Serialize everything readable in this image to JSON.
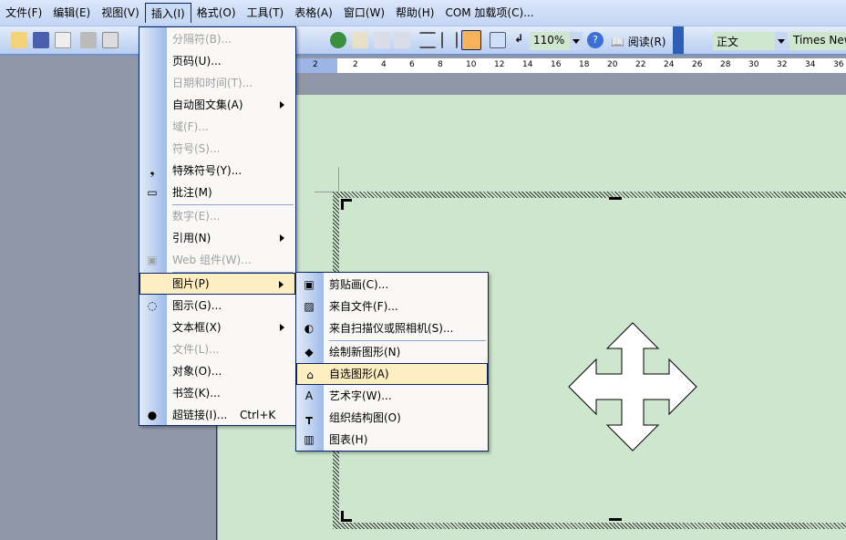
{
  "menubar": [
    "文件(F)",
    "编辑(E)",
    "视图(V)",
    "插入(I)",
    "格式(O)",
    "工具(T)",
    "表格(A)",
    "窗口(W)",
    "帮助(H)",
    "COM 加载项(C)..."
  ],
  "toolbar": {
    "zoom": "110%",
    "read": "阅读(R)",
    "style": "正文",
    "font": "Times New"
  },
  "ruler": [
    "2",
    "2",
    "4",
    "6",
    "8",
    "10",
    "12",
    "14",
    "16",
    "18",
    "20",
    "22",
    "24",
    "26",
    "28",
    "30",
    "32",
    "34",
    "36"
  ],
  "insert_menu": [
    {
      "label": "分隔符(B)...",
      "disabled": true
    },
    {
      "label": "页码(U)..."
    },
    {
      "label": "日期和时间(T)...",
      "disabled": true
    },
    {
      "label": "自动图文集(A)",
      "sub": true
    },
    {
      "label": "域(F)...",
      "disabled": true
    },
    {
      "label": "符号(S)...",
      "disabled": true
    },
    {
      "label": "特殊符号(Y)...",
      "icon": "comma-icon"
    },
    {
      "label": "批注(M)",
      "icon": "comment-icon"
    },
    {
      "label": "数字(E)...",
      "disabled": true
    },
    {
      "label": "引用(N)",
      "sub": true
    },
    {
      "label": "Web 组件(W)...",
      "disabled": true,
      "icon": "web-component-icon"
    },
    {
      "label": "图片(P)",
      "sub": true,
      "highlighted": true
    },
    {
      "label": "图示(G)...",
      "icon": "diagram-icon"
    },
    {
      "label": "文本框(X)",
      "sub": true
    },
    {
      "label": "文件(L)...",
      "disabled": true
    },
    {
      "label": "对象(O)..."
    },
    {
      "label": "书签(K)..."
    },
    {
      "label": "超链接(I)...",
      "shortcut": "Ctrl+K",
      "icon": "hyperlink-icon"
    }
  ],
  "picture_menu": [
    {
      "label": "剪贴画(C)...",
      "icon": "clipart-icon"
    },
    {
      "label": "来自文件(F)...",
      "icon": "picture-file-icon"
    },
    {
      "label": "来自扫描仪或照相机(S)...",
      "icon": "scanner-icon"
    },
    {
      "label": "绘制新图形(N)",
      "icon": "new-drawing-icon"
    },
    {
      "label": "自选图形(A)",
      "icon": "autoshape-icon",
      "highlighted": true
    },
    {
      "label": "艺术字(W)...",
      "icon": "wordart-icon"
    },
    {
      "label": "组织结构图(O)",
      "icon": "org-chart-icon"
    },
    {
      "label": "图表(H)",
      "icon": "chart-icon"
    }
  ]
}
